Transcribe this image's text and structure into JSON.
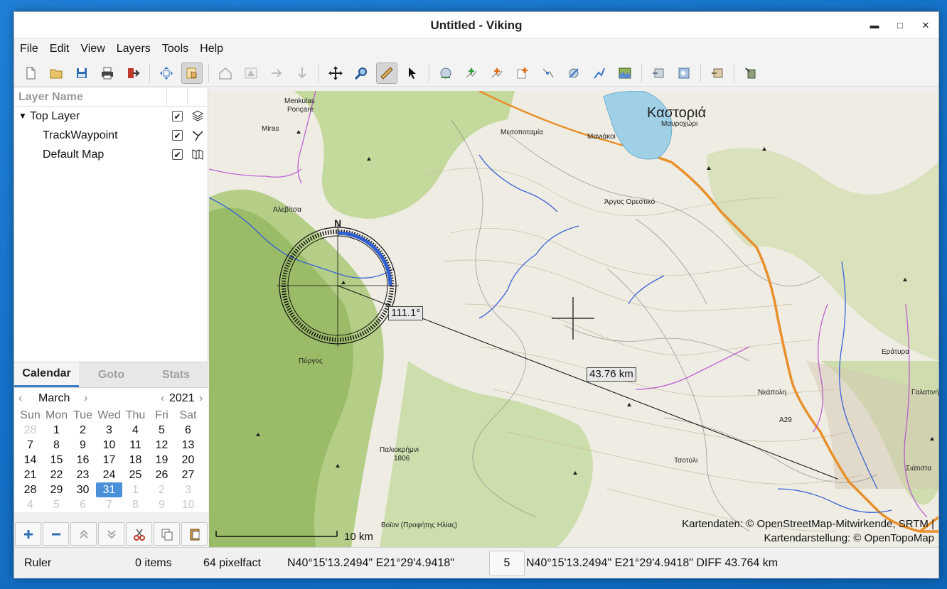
{
  "window": {
    "title": "Untitled - Viking"
  },
  "menu": [
    "File",
    "Edit",
    "View",
    "Layers",
    "Tools",
    "Help"
  ],
  "layers": {
    "header": "Layer Name",
    "items": [
      {
        "label": "Top Layer",
        "checked": true,
        "icon": "layers-icon"
      },
      {
        "label": "TrackWaypoint",
        "checked": true,
        "icon": "track-waypoint-icon"
      },
      {
        "label": "Default Map",
        "checked": true,
        "icon": "map-icon"
      }
    ]
  },
  "sidetabs": [
    "Calendar",
    "Goto",
    "Stats"
  ],
  "calendar": {
    "month": "March",
    "year": "2021",
    "weekdays": [
      "Sun",
      "Mon",
      "Tue",
      "Wed",
      "Thu",
      "Fri",
      "Sat"
    ],
    "days": [
      "28",
      "1",
      "2",
      "3",
      "4",
      "5",
      "6",
      "7",
      "8",
      "9",
      "10",
      "11",
      "12",
      "13",
      "14",
      "15",
      "16",
      "17",
      "18",
      "19",
      "20",
      "21",
      "22",
      "23",
      "24",
      "25",
      "26",
      "27",
      "28",
      "29",
      "30",
      "31",
      "1",
      "2",
      "3",
      "4",
      "5",
      "6",
      "7",
      "8",
      "9",
      "10"
    ],
    "selected": "31"
  },
  "map": {
    "labels": {
      "kastoria": "Καστοριά",
      "mavrochori": "Μαυροχώρι",
      "mesopotamia": "Μεσοποταμία",
      "maniakoi": "Μανιάκοι",
      "argos": "Άργος Ορεστικό",
      "menkulas": "Menkulas",
      "poncare": "Ponçare",
      "miras": "Miras",
      "alevitsa": "Αλεβίτσα",
      "pyrgos": "Πύργος",
      "palaiokrimini": "Παλιοκρήμνι",
      "alt1806": "1806",
      "neapoli": "Νεάπολη",
      "tsotyli": "Τσοτύλι",
      "siatista": "Σιάτιστα",
      "galatini": "Γαλατινή",
      "eratyra": "Εράτυρα",
      "voion": "Βοϊον (Προφήτης Ηλίας)",
      "a29": "A29"
    },
    "compass_n": "N",
    "bearing": "111.1°",
    "distance": "43.76 km",
    "scale": "10 km",
    "attribution_1": "Kartendaten: © OpenStreetMap-Mitwirkende, SRTM |",
    "attribution_2": "Kartendarstellung: © OpenTopoMap"
  },
  "status": {
    "tool": "Ruler",
    "items": "0 items",
    "zoom_factor": "64 pixelfact",
    "position": "N40°15'13.2494\" E21°29'4.9418\"",
    "zoom_level": "5",
    "ruler_info": "N40°15'13.2494\" E21°29'4.9418\" DIFF 43.764 km"
  },
  "colors": {
    "accent": "#4a90d9",
    "water": "#9fd0e6",
    "road_major": "#e8902a",
    "forest": "#b9d48a"
  }
}
